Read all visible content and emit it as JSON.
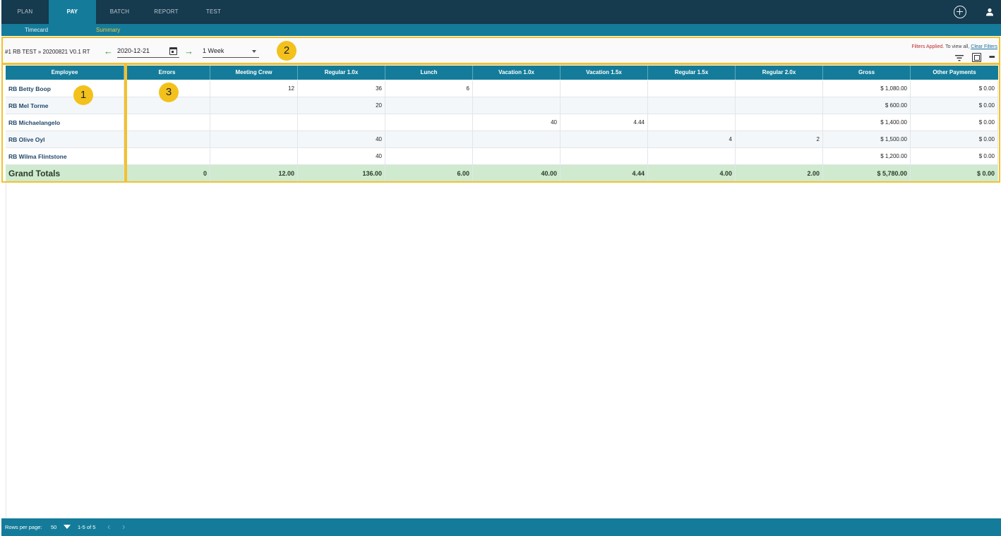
{
  "nav": {
    "tabs": [
      {
        "label": "PLAN"
      },
      {
        "label": "PAY"
      },
      {
        "label": "BATCH"
      },
      {
        "label": "REPORT"
      },
      {
        "label": "TEST"
      }
    ],
    "active_tab": "PAY",
    "icons": [
      "plus-circle-icon",
      "person-icon"
    ]
  },
  "subnav": {
    "tabs": [
      {
        "label": "Timecard"
      },
      {
        "label": "Summary"
      }
    ],
    "active_tab": "Summary"
  },
  "toolbar": {
    "project": "#1 RB TEST » 20200821 V0.1 RT",
    "date": "2020-12-21",
    "period": "1 Week",
    "filters_applied": "Filters Applied.",
    "filters_hint": " To view all, ",
    "clear_filters": "Clear Filters"
  },
  "badges": [
    "1",
    "2",
    "3"
  ],
  "table": {
    "columns": [
      "Employee",
      "Errors",
      "Meeting Crew",
      "Regular 1.0x",
      "Lunch",
      "Vacation 1.0x",
      "Vacation 1.5x",
      "Regular 1.5x",
      "Regular 2.0x",
      "Gross",
      "Other Payments"
    ],
    "rows": [
      [
        "RB Betty Boop",
        "",
        "12",
        "36",
        "6",
        "",
        "",
        "",
        "",
        "$ 1,080.00",
        "$ 0.00"
      ],
      [
        "RB Mel Torme",
        "",
        "",
        "20",
        "",
        "",
        "",
        "",
        "",
        "$ 600.00",
        "$ 0.00"
      ],
      [
        "RB Michaelangelo",
        "",
        "",
        "",
        "",
        "40",
        "4.44",
        "",
        "",
        "$ 1,400.00",
        "$ 0.00"
      ],
      [
        "RB Olive Oyl",
        "",
        "",
        "40",
        "",
        "",
        "",
        "4",
        "2",
        "$ 1,500.00",
        "$ 0.00"
      ],
      [
        "RB Wilma Flintstone",
        "",
        "",
        "40",
        "",
        "",
        "",
        "",
        "",
        "$ 1,200.00",
        "$ 0.00"
      ]
    ],
    "totals": [
      "Grand Totals",
      "0",
      "12.00",
      "136.00",
      "6.00",
      "40.00",
      "4.44",
      "4.00",
      "2.00",
      "$ 5,780.00",
      "$ 0.00"
    ]
  },
  "footer": {
    "rows_per_page_label": "Rows per page:",
    "rows_per_page": "50",
    "range": "1-5 of 5"
  },
  "colors": {
    "nav_bg": "#163a4e",
    "accent": "#147c9a",
    "highlight": "#f2c12e",
    "totals_bg": "#cfeacf"
  }
}
